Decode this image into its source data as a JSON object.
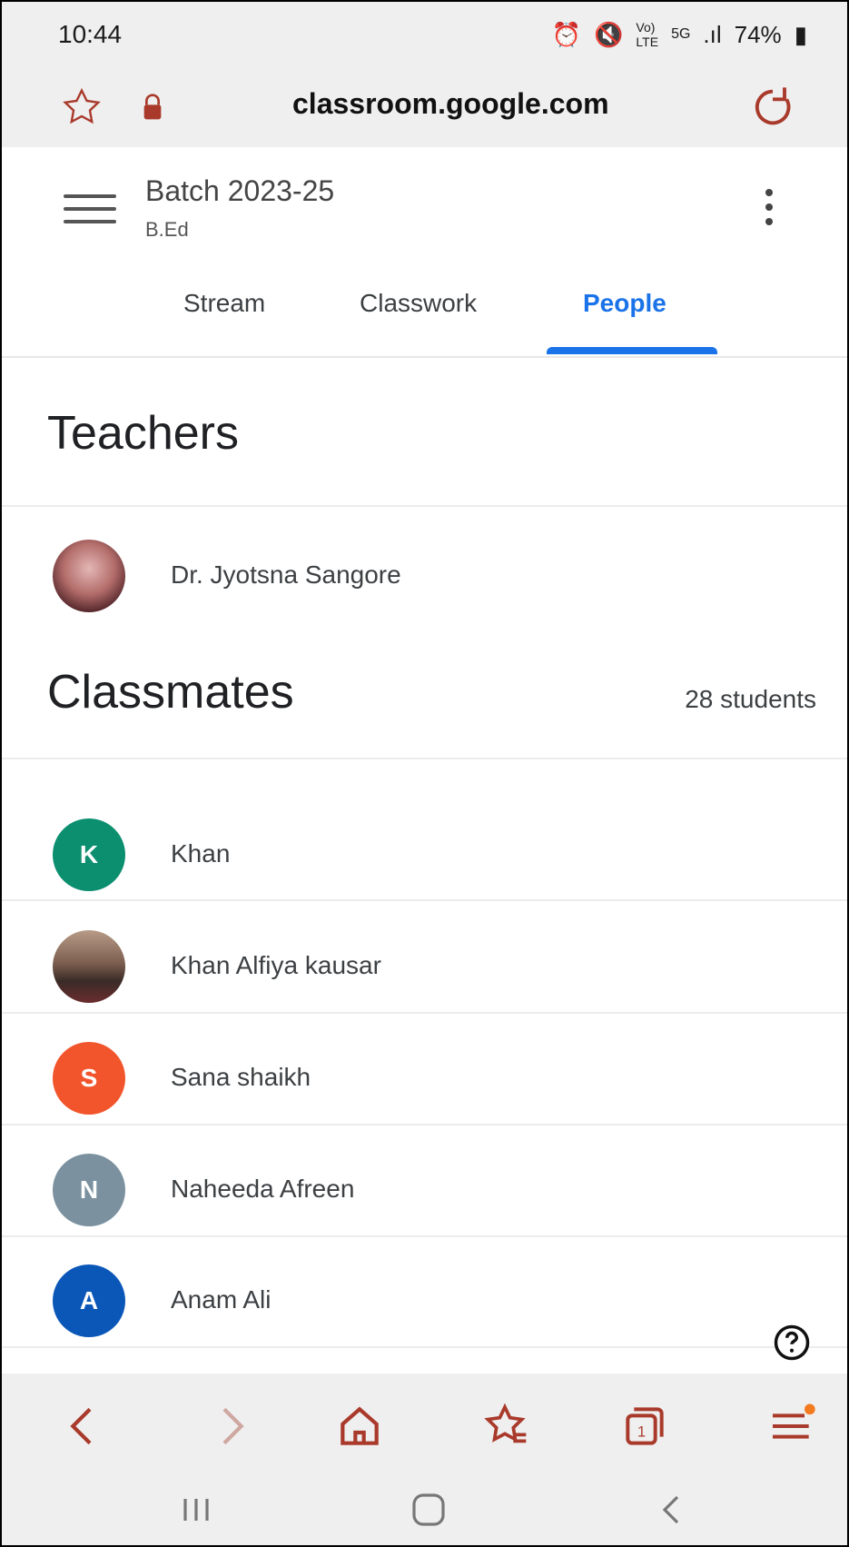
{
  "status": {
    "time": "10:44",
    "icons": [
      "alarm-icon",
      "mute-icon",
      "volte-icon",
      "5g-icon",
      "signal-icon"
    ],
    "battery": "74%"
  },
  "browser": {
    "url": "classroom.google.com"
  },
  "classroom": {
    "title": "Batch 2023-25",
    "subtitle": "B.Ed"
  },
  "tabs": [
    "Stream",
    "Classwork",
    "People"
  ],
  "active_tab": "People",
  "sections": {
    "teachers_title": "Teachers",
    "classmates_title": "Classmates",
    "student_count": "28 students"
  },
  "teachers": [
    {
      "name": "Dr. Jyotsna Sangore",
      "avatar": "photo"
    }
  ],
  "classmates": [
    {
      "name": "Khan",
      "initial": "K",
      "color": "#0b8f6f"
    },
    {
      "name": "Khan Alfiya kausar",
      "initial": "",
      "color": "#8b6a58"
    },
    {
      "name": "Sana shaikh",
      "initial": "S",
      "color": "#f2552c"
    },
    {
      "name": "Naheeda Afreen",
      "initial": "N",
      "color": "#7b919f"
    },
    {
      "name": "Anam Ali",
      "initial": "A",
      "color": "#0b57b8"
    }
  ],
  "colors": {
    "accent": "#1a73e8",
    "browser_icon": "#a93a2b",
    "badge": "#f47a20"
  }
}
